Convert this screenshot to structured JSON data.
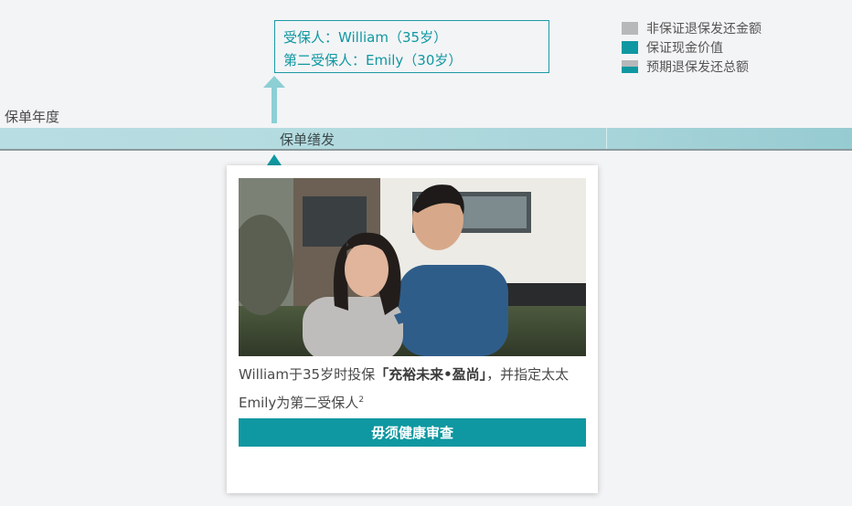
{
  "insured": {
    "line1": "受保人：William（35岁）",
    "line2": "第二受保人：Emily（30岁）"
  },
  "legend": [
    {
      "label": "非保证退保发还金额",
      "color": "#b6b8ba"
    },
    {
      "label": "保证现金价值",
      "color": "#0f98a1"
    },
    {
      "label": "预期退保发还总额",
      "color": "split-grey-teal"
    }
  ],
  "timeline": {
    "axis_label": "保单年度",
    "issue_label": "保单缮发"
  },
  "card": {
    "photo_icon": "couple-photo",
    "text": {
      "prefix": "William于35岁时投保",
      "product": "「充裕未来•盈尚」",
      "suffix": "，并指定太太Emily为第二受保人",
      "footnote": "2"
    },
    "button_label": "毋须健康审查"
  },
  "colors": {
    "accent": "#0f98a1",
    "band": "#b5dce0",
    "grey": "#b6b8ba"
  }
}
